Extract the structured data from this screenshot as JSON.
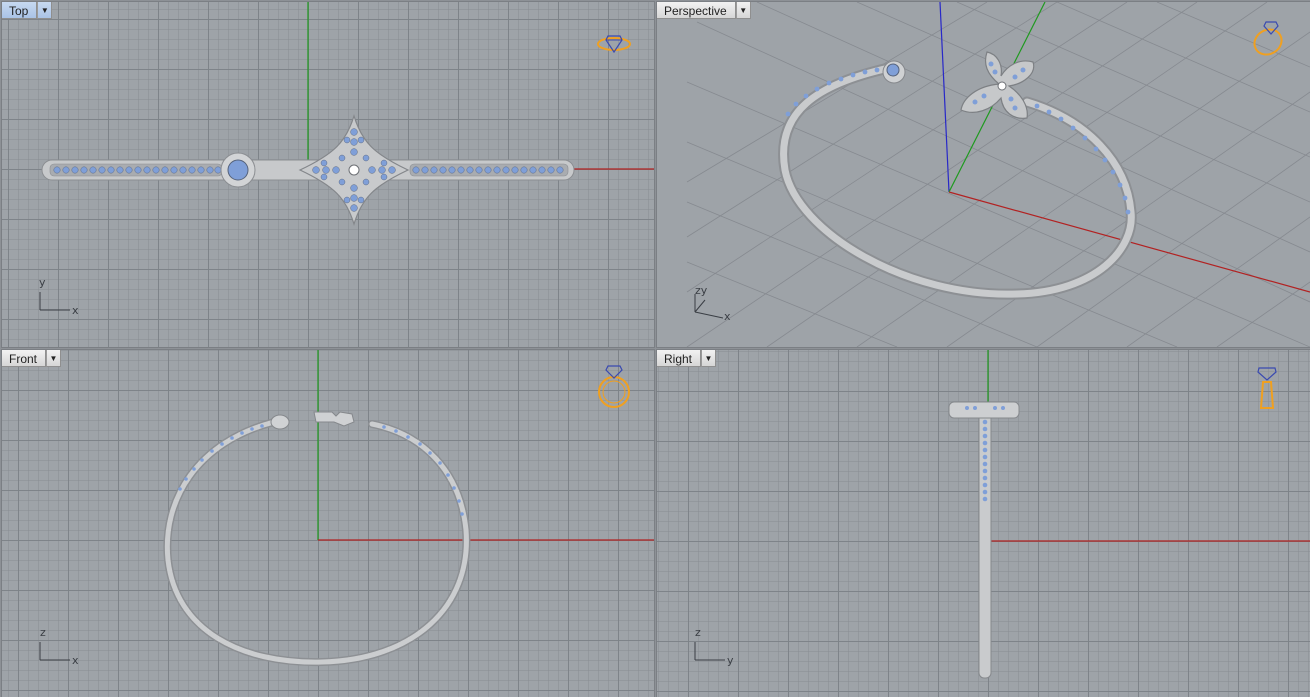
{
  "viewports": {
    "top": {
      "title": "Top",
      "axes": {
        "vertical": "y",
        "horizontal": "x"
      },
      "widget_icon": "ring-top-view-icon"
    },
    "persp": {
      "title": "Perspective",
      "axes": {
        "vertical": "zy",
        "horizontal": "x"
      },
      "widget_icon": "ring-perspective-view-icon"
    },
    "front": {
      "title": "Front",
      "axes": {
        "vertical": "z",
        "horizontal": "x"
      },
      "widget_icon": "ring-front-view-icon"
    },
    "right": {
      "title": "Right",
      "axes": {
        "vertical": "z",
        "horizontal": "y"
      },
      "widget_icon": "ring-side-view-icon"
    }
  },
  "dropdown_glyph": "▼",
  "colors": {
    "viewport_bg": "#9ea3a8",
    "grid_minor": "#8a8e94",
    "grid_major": "#7d8288",
    "x_axis": "#b22222",
    "y_axis": "#1f9a1f",
    "z_axis": "#2828c8",
    "metal": "#c4c6c8",
    "gem": "#7f9fd8",
    "widget": "#f0a020",
    "active_tab": "#b3cae8"
  }
}
